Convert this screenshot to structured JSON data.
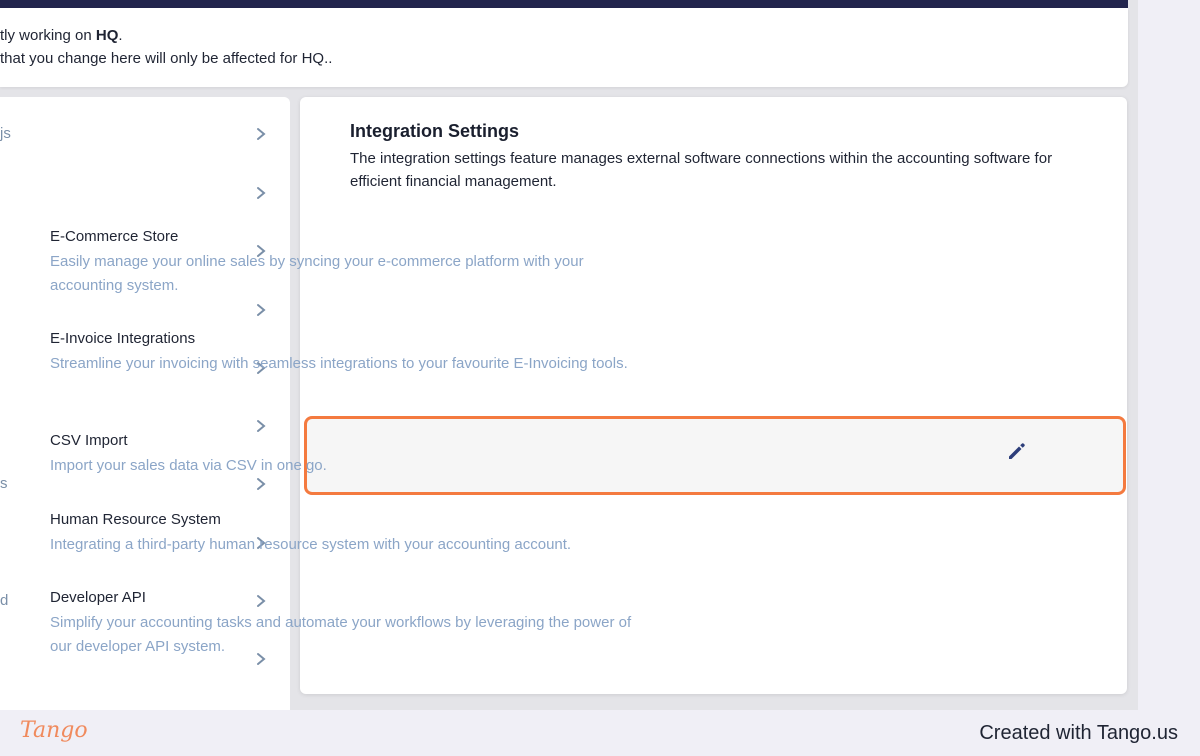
{
  "banner": {
    "line1_prefix": "tly working on ",
    "line1_bold": "HQ",
    "line1_suffix": ".",
    "line2": " that you change here will only be affected for HQ.."
  },
  "sidebar": {
    "items": [
      {
        "label": "js"
      },
      {
        "label": ""
      },
      {
        "label": ""
      },
      {
        "label": ""
      },
      {
        "label": ""
      },
      {
        "label": ""
      },
      {
        "label": "s"
      },
      {
        "label": ""
      },
      {
        "label": "d"
      },
      {
        "label": ""
      }
    ]
  },
  "main": {
    "title": "Integration Settings",
    "description": "The integration settings feature manages external software connections within the accounting software for efficient financial management.",
    "settings": [
      {
        "title": "E-Commerce Store",
        "description": "Easily manage your online sales by syncing your e-commerce platform with your accounting system."
      },
      {
        "title": "E-Invoice Integrations",
        "description": "Streamline your invoicing with seamless integrations to your favourite E-Invoicing tools."
      },
      {
        "title": "CSV Import",
        "description": "Import your sales data via CSV in one go."
      },
      {
        "title": "Human Resource System",
        "description": "Integrating a third-party human resource system with your accounting account."
      },
      {
        "title": "Developer API",
        "description": "Simplify your accounting tasks and automate your workflows by leveraging the power of our developer API system."
      }
    ]
  },
  "icons": {
    "chevron": "chevron-right-icon",
    "edit": "pencil-icon"
  },
  "colors": {
    "highlight_border": "#f47a3f",
    "accent_dark": "#22254d",
    "muted_text": "#8ba5c7",
    "edit_icon": "#2d3e7a"
  },
  "footer": {
    "logo": "Tango",
    "credit": "Created with Tango.us"
  }
}
